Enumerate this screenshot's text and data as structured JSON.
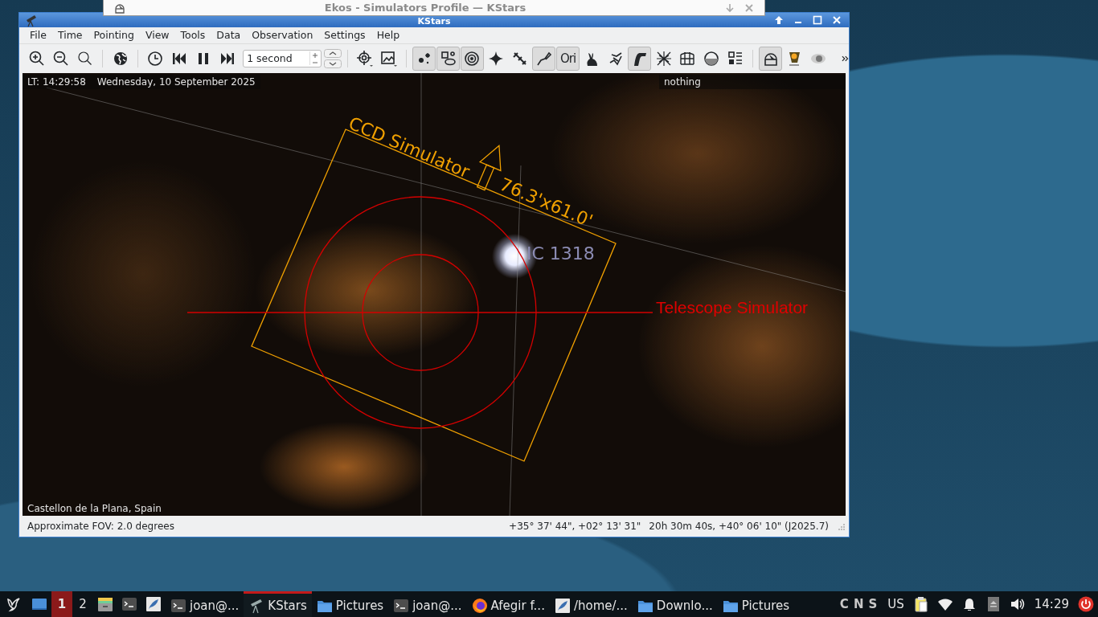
{
  "ekos_window": {
    "title": "Ekos - Simulators Profile — KStars"
  },
  "kstars_window": {
    "title": "KStars",
    "menu": [
      "File",
      "Time",
      "Pointing",
      "View",
      "Tools",
      "Data",
      "Observation",
      "Settings",
      "Help"
    ],
    "toolbar": {
      "time_step": "1 second",
      "view_toggles": [
        {
          "selected": true
        },
        {
          "selected": true
        },
        {
          "selected": true
        },
        {
          "selected": false
        },
        {
          "selected": false
        },
        {
          "selected": true
        },
        {
          "selected": true,
          "label": "Ori"
        },
        {
          "selected": false
        },
        {
          "selected": false
        },
        {
          "selected": true
        },
        {
          "selected": false
        },
        {
          "selected": false
        },
        {
          "selected": false
        },
        {
          "selected": false
        },
        {
          "selected": true
        },
        {
          "selected": false
        },
        {
          "selected": false
        }
      ]
    },
    "sky_map": {
      "time": "LT: 14:29:58",
      "date": "Wednesday, 10 September 2025",
      "focus_object": "nothing",
      "location": "Castellon de la Plana, Spain",
      "ccd_name": "CCD Simulator",
      "ccd_fov": "76.3'x61.0'",
      "object_label": "IC 1318",
      "telescope_name": "Telescope Simulator"
    },
    "status_bar": {
      "fov": "Approximate FOV: 2.0 degrees",
      "horizontal": "+35° 37' 44\", +02° 13' 31\"",
      "equatorial": "20h 30m 40s, +40° 06' 10\" (J2025.7)"
    }
  },
  "taskbar": {
    "workspaces": [
      {
        "label": "1",
        "selected": true
      },
      {
        "label": "2",
        "selected": false
      }
    ],
    "tasks": [
      {
        "label": "joan@...",
        "selected": false
      },
      {
        "label": "KStars",
        "selected": true
      },
      {
        "label": "Pictures",
        "selected": false
      },
      {
        "label": "joan@...",
        "selected": false
      },
      {
        "label": "Afegir f...",
        "selected": false
      },
      {
        "label": "/home/...",
        "selected": false
      },
      {
        "label": "Downlo...",
        "selected": false
      },
      {
        "label": "Pictures",
        "selected": false
      }
    ],
    "lock_keys": [
      "C",
      "N",
      "S"
    ],
    "keyboard_layout": "US",
    "clock": "14:29"
  }
}
